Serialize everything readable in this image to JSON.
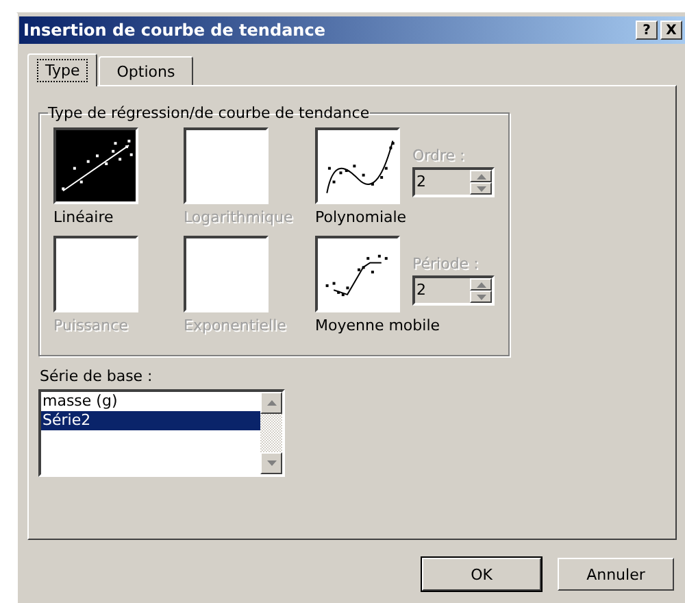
{
  "window": {
    "title": "Insertion de courbe de tendance",
    "title_buttons": [
      "?",
      "X"
    ]
  },
  "tabs": [
    {
      "label": "Type",
      "selected": true
    },
    {
      "label": "Options",
      "selected": false
    }
  ],
  "regression_group": {
    "legend": "Type de régression/de courbe de tendance",
    "types": [
      {
        "kind": "linear",
        "label": "Linéaire",
        "selected": true,
        "disabled": false
      },
      {
        "kind": "logarithmic",
        "label": "Logarithmique",
        "selected": false,
        "disabled": true
      },
      {
        "kind": "polynomial",
        "label": "Polynomiale",
        "selected": false,
        "disabled": false,
        "spinner": {
          "label": "Ordre :",
          "value": "2",
          "disabled": true
        }
      },
      {
        "kind": "power",
        "label": "Puissance",
        "selected": false,
        "disabled": true
      },
      {
        "kind": "exponential",
        "label": "Exponentielle",
        "selected": false,
        "disabled": true
      },
      {
        "kind": "moving_average",
        "label": "Moyenne mobile",
        "selected": false,
        "disabled": false,
        "spinner": {
          "label": "Période :",
          "value": "2",
          "disabled": true
        }
      }
    ]
  },
  "base_series": {
    "label": "Série de base :",
    "items": [
      {
        "label": "masse (g)",
        "selected": false
      },
      {
        "label": "Série2",
        "selected": true
      }
    ]
  },
  "buttons": [
    {
      "label": "OK",
      "default": true
    },
    {
      "label": "Annuler",
      "default": false
    }
  ]
}
